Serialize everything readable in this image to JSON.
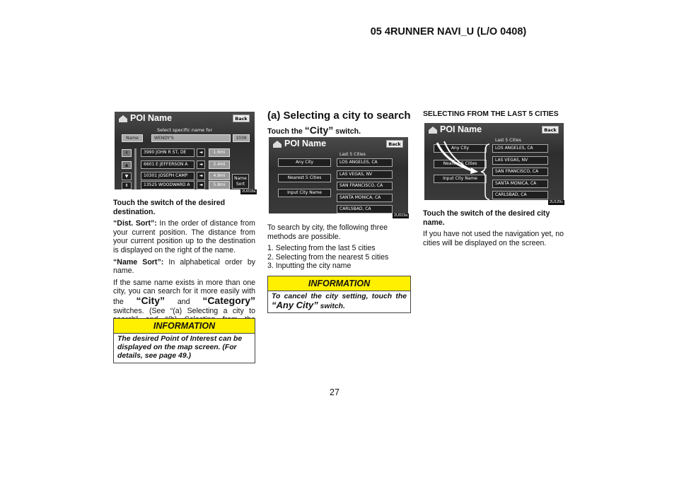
{
  "header": {
    "title": "05 4RUNNER NAVI_U (L/O 0408)"
  },
  "page_number": "27",
  "screen_common": {
    "title": "POI Name",
    "back": "Back",
    "home_icon": "house-icon"
  },
  "screen1": {
    "prompt": "Select specific name for",
    "name_button": "Name",
    "name_value": "WENDY'S",
    "count": "1039",
    "rows": [
      {
        "name": "3990 JOHN R ST, DE",
        "dist": "1.6mi"
      },
      {
        "name": "6601 E JEFFERSON A",
        "dist": "2.4mi"
      },
      {
        "name": "10301 JOSEPH CAMP",
        "dist": "4.9mi"
      },
      {
        "name": "13525 WOODWARD A",
        "dist": "5.8mi"
      }
    ],
    "sort_button": "Name Sort",
    "arrow": "◄",
    "up_fast": "⇞",
    "up": "▲",
    "down": "▼",
    "down_fast": "⇟",
    "label": "2U018a"
  },
  "screen2": {
    "left_buttons": [
      "Any City",
      "Nearest 5 Cities",
      "Input City Name"
    ],
    "last_caption": "Last 5 Cities",
    "cities": [
      "LOS ANGELES, CA",
      "LAS VEGAS, NV",
      "SAN FRANCISCO, CA",
      "SANTA MONICA, CA",
      "CARLSBAD, CA"
    ],
    "label": "2U019a"
  },
  "screen3": {
    "left_buttons": [
      "Any City",
      "Nearest 5 Cities",
      "Input City Name"
    ],
    "last_caption": "Last 5 Cities",
    "cities": [
      "LOS ANGELES, CA",
      "LAS VEGAS, NV",
      "SAN FRANCISCO, CA",
      "SANTA MONICA, CA",
      "CARLSBAD, CA"
    ],
    "label": "2U120c"
  },
  "col1": {
    "heading": "Touch the switch of the desired destination.",
    "dist_term": "“Dist. Sort”:",
    "dist_text": " In the order of distance from your current position.  The distance from your current position up to the destination is displayed on the right of the name.",
    "name_term": "“Name Sort”:",
    "name_text": " In alphabetical order by name.",
    "para_a": "If the same name exists in more than one city, you can search for it more easily with the ",
    "city": "“City”",
    "and": " and ",
    "category": "“Category”",
    "para_b": " switches.  (See “(a) Selecting a city to search” and “(b) Selecting from the categories”.)",
    "info_title": "INFORMATION",
    "info_text": "The desired Point of Interest can be displayed on the map screen.  (For details, see page 49.)"
  },
  "col2": {
    "heading": "(a) Selecting a city to search",
    "touch_a": "Touch the ",
    "city": "“City”",
    "touch_b": " switch.",
    "intro": "To search by city, the following three methods are possible.",
    "methods": [
      "1.  Selecting from the last 5 cities",
      "2.  Selecting from the nearest 5 cities",
      "3.  Inputting the city name"
    ],
    "info_title": "INFORMATION",
    "info_a": "To cancel the city setting, touch the ",
    "info_city": "“Any City”",
    "info_b": " switch."
  },
  "col3": {
    "heading": "SELECTING FROM THE LAST 5 CITIES",
    "bold_line": "Touch the switch of the desired city name.",
    "text": "If you have not used the navigation yet, no cities will be displayed on the screen."
  }
}
